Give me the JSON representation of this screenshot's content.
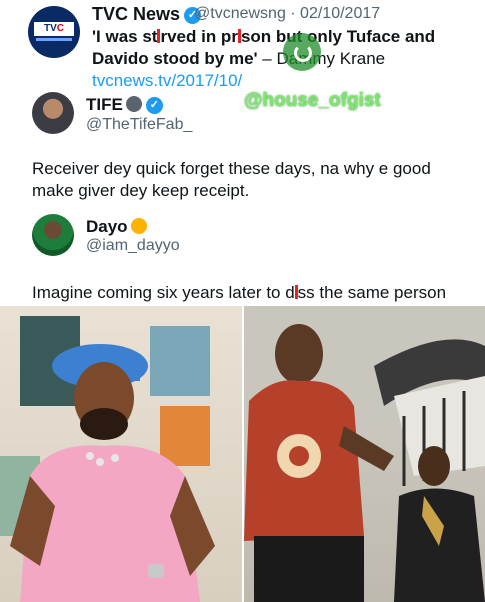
{
  "tweet": {
    "name": "TVC News",
    "handle": "@tvcnewsng · 02/10/2017",
    "text_part1": "'I was st",
    "text_part2": "rved in pr",
    "text_part3": "son but ",
    "text_bold": "only Tuface and Davido stood by me'",
    "text_part4": " – Dammy Krane ",
    "link": "tvcnews.tv/2017/10/",
    "logo_text_a": "TV",
    "logo_text_b": "C",
    "logo_text_c": " NEWS"
  },
  "watermark": "@house_ofgist",
  "reply1": {
    "name": "TIFE",
    "handle": "@TheTifeFab_",
    "text": "Receiver dey quick forget these days, na why e good make giver dey keep receipt."
  },
  "reply2": {
    "name": "Dayo",
    "handle": "@iam_dayyo",
    "text_a": "Imagine coming six years later to d",
    "text_b": "ss the same person"
  },
  "colors": {
    "verified": "#1d9bf0",
    "link": "#1d9bf0",
    "watermark": "#7be86a",
    "shirt_pink": "#f4a7c4",
    "cap_blue": "#3d7fd1"
  },
  "icons": [
    "verified-badge-icon",
    "face-emoji-icon",
    "dizzy-emoji-icon",
    "shazam-ring-icon"
  ]
}
